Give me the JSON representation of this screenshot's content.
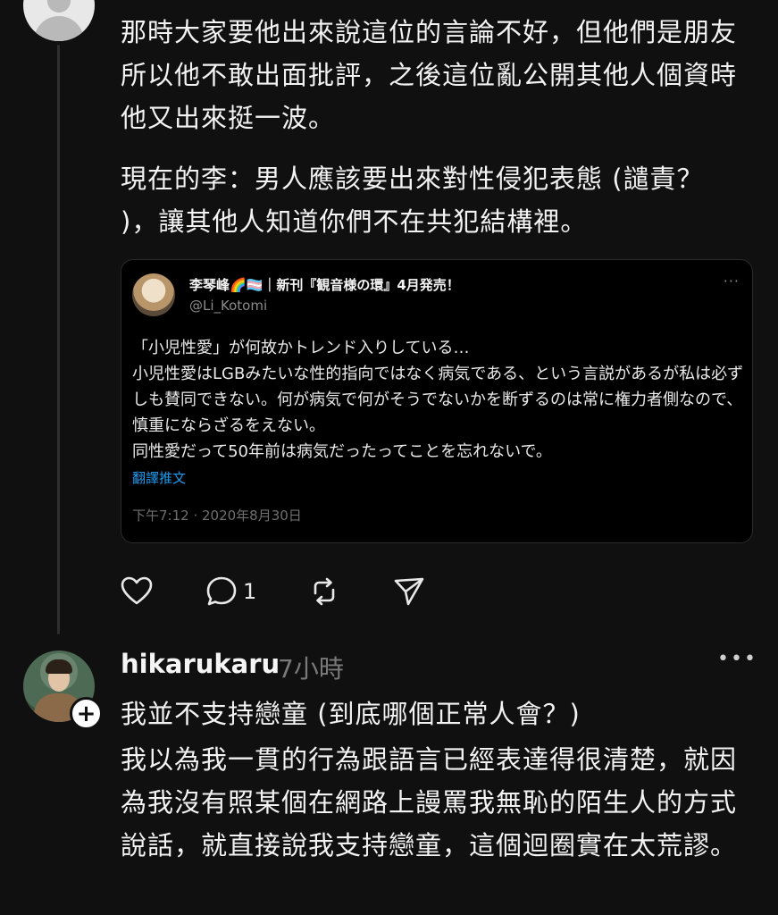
{
  "post1": {
    "paragraph1": "那時大家要他出來說這位的言論不好，但他們是朋友所以他不敢出面批評，之後這位亂公開其他人個資時他又出來挺一波。",
    "paragraph2": "現在的李：男人應該要出來對性侵犯表態 (譴責？ )，讓其他人知道你們不在共犯結構裡。",
    "quote": {
      "name": "李琴峰🌈🏳️‍⚧️｜新刊『観音様の環』4月発売！",
      "handle": "@Li_Kotomi",
      "more": "···",
      "text": "「小児性愛」が何故かトレンド入りしている…\n小児性愛はLGBみたいな性的指向ではなく病気である、という言説があるが私は必ずしも賛同できない。何が病気で何がそうでないかを断ずるのは常に権力者側なので、慎重にならざるをえない。\n同性愛だって50年前は病気だったってことを忘れないで。",
      "translate_label": "翻譯推文",
      "timestamp": "下午7:12 · 2020年8月30日"
    },
    "actions": {
      "like_icon": "heart-icon",
      "reply_icon": "comment-icon",
      "reply_count": "1",
      "repost_icon": "repost-icon",
      "share_icon": "send-icon"
    }
  },
  "post2": {
    "username": "hikarukaru",
    "time": "7小時",
    "more": "•••",
    "follow_label": "+",
    "paragraph1": "我並不支持戀童 (到底哪個正常人會？)",
    "paragraph2": "我以為我一貫的行為跟語言已經表達得很清楚，就因為我沒有照某個在網路上謾罵我無恥的陌生人的方式說話，就直接說我支持戀童，這個迴圈實在太荒謬。"
  },
  "colors": {
    "background": "#101010",
    "text": "#f3f3f3",
    "muted": "#7a7a7a",
    "link": "#1d9bf0"
  }
}
